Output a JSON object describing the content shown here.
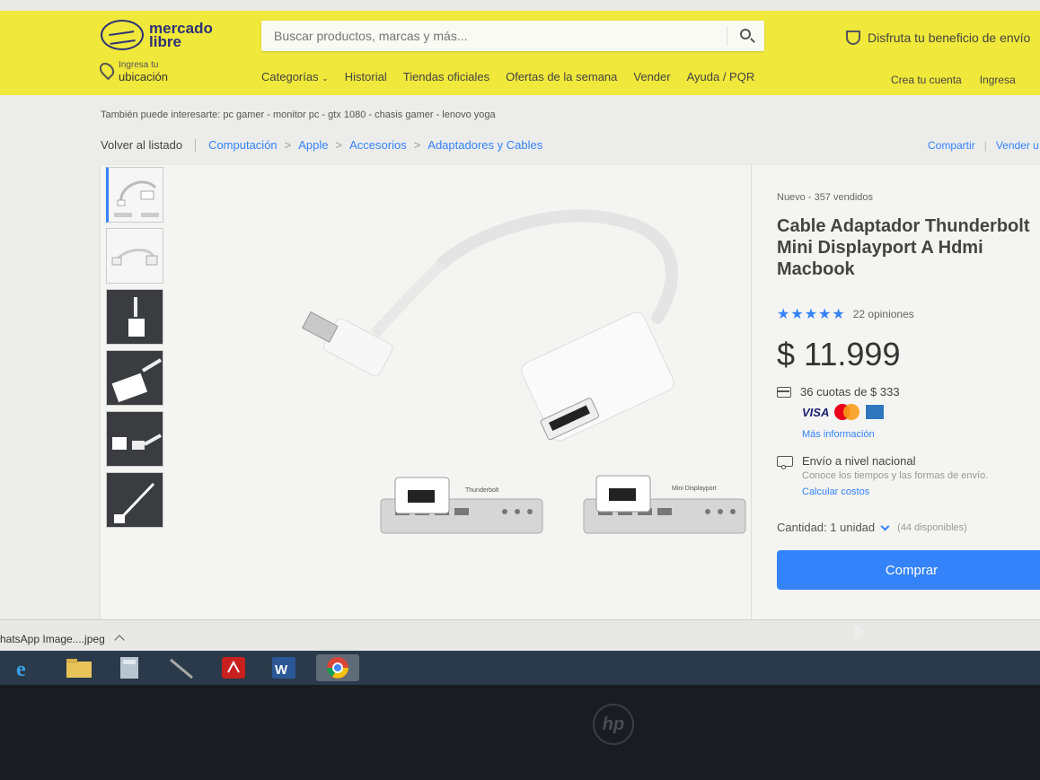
{
  "header": {
    "logo_line1": "mercado",
    "logo_line2": "libre",
    "search_placeholder": "Buscar productos, marcas y más...",
    "promo": "Disfruta tu beneficio de envío",
    "location_line1": "Ingresa tu",
    "location_line2": "ubicación",
    "nav": [
      "Categorías",
      "Historial",
      "Tiendas oficiales",
      "Ofertas de la semana",
      "Vender",
      "Ayuda / PQR"
    ],
    "account": [
      "Crea tu cuenta",
      "Ingresa"
    ]
  },
  "related": "También puede interesarte: pc gamer - monitor pc - gtx 1080 - chasis gamer - lenovo yoga",
  "breadcrumb": {
    "back": "Volver al listado",
    "items": [
      "Computación",
      "Apple",
      "Accesorios",
      "Adaptadores y Cables"
    ],
    "share": "Compartir",
    "sell": "Vender u"
  },
  "gallery": {
    "label_thunderbolt": "Thunderbolt",
    "label_minidp": "Mini Displayport"
  },
  "product": {
    "condition": "Nuevo  -  357 vendidos",
    "title": "Cable Adaptador Thunderbolt Mini Displayport A Hdmi Macbook",
    "stars": "★★★★★",
    "reviews": "22 opiniones",
    "price": "$ 11.999",
    "installments": "36 cuotas de $ 333",
    "visa": "VISA",
    "more_info": "Más información",
    "shipping": "Envío a nivel nacional",
    "shipping_sub": "Conoce los tiempos y las formas de envío.",
    "calc": "Calcular costos",
    "quantity": "Cantidad: 1 unidad",
    "available": "(44 disponibles)",
    "buy": "Comprar"
  },
  "download": {
    "file": "hatsApp Image....jpeg"
  },
  "laptop_brand": "hp"
}
